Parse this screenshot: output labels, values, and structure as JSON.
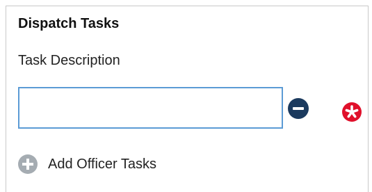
{
  "section": {
    "title": "Dispatch Tasks"
  },
  "task_description": {
    "label": "Task Description",
    "value": "",
    "placeholder": ""
  },
  "icons": {
    "remove": "minus-circle-icon",
    "required": "asterisk-required-icon",
    "add": "plus-circle-icon"
  },
  "add_officer_tasks": {
    "label": "Add Officer Tasks"
  },
  "colors": {
    "input_border": "#5b9bd5",
    "remove_button": "#1b3a5e",
    "required_icon": "#e0102b",
    "add_icon": "#a5acb2"
  }
}
